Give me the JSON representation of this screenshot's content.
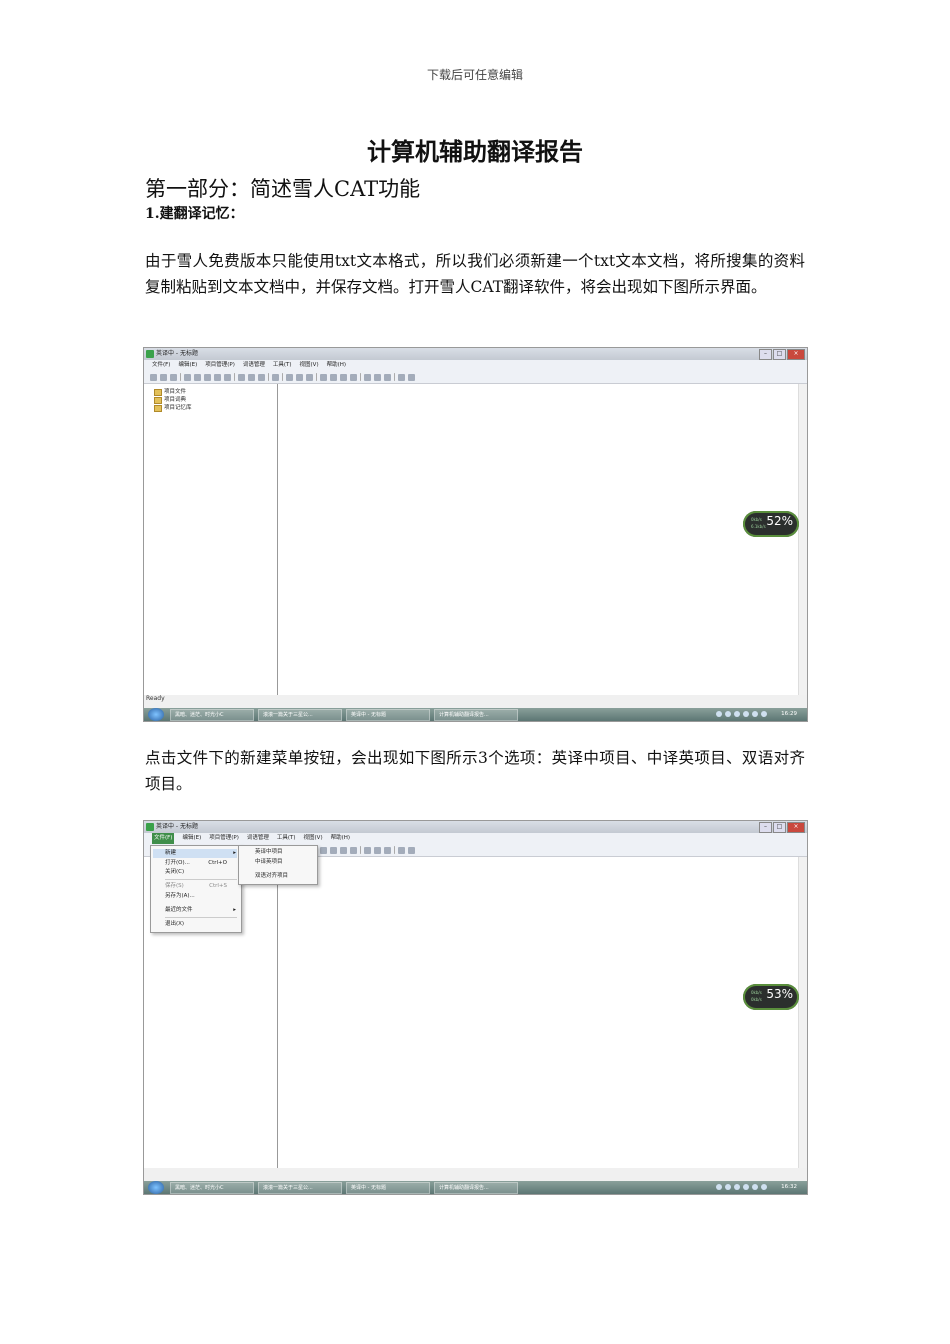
{
  "header": "下载后可任意编辑",
  "title": "计算机辅助翻译报告",
  "section_heading": "第一部分：简述雪人CAT功能",
  "subheading": "1.建翻译记忆：",
  "paragraph1": "由于雪人免费版本只能使用txt文本格式，所以我们必须新建一个txt文本文档，将所搜集的资料复制粘贴到文本文档中，并保存文档。打开雪人CAT翻译软件，将会出现如下图所示界面。",
  "paragraph2": "点击文件下的新建菜单按钮，会出现如下图所示3个选项：英译中项目、中译英项目、双语对齐项目。",
  "screenshot1": {
    "window_title": "英译中 - 无标题",
    "menu": [
      "文件(F)",
      "编辑(E)",
      "项目管理(P)",
      "词语管理",
      "工具(T)",
      "视图(V)",
      "帮助(H)"
    ],
    "tree": [
      "项目文件",
      "项目词典",
      "项目记忆库"
    ],
    "status": "Ready",
    "taskbar": [
      "黑暗、迷茫、时光小C",
      "滚滚一篇关于三星公...",
      "英译中 - 无标题",
      "计算机辅助翻译报告..."
    ],
    "clock": "16:29",
    "gadget_percent": "52%",
    "gadget_stats": [
      "0kb/s",
      "6.1kb/s"
    ]
  },
  "screenshot2": {
    "window_title": "英译中 - 无标题",
    "menu": [
      "文件(F)",
      "编辑(E)",
      "项目管理(P)",
      "词语管理",
      "工具(T)",
      "视图(V)",
      "帮助(H)"
    ],
    "file_menu": [
      {
        "label": "新建",
        "shortcut": "",
        "arrow": "▸"
      },
      {
        "label": "打开(O)...",
        "shortcut": "Ctrl+O",
        "arrow": ""
      },
      {
        "label": "关闭(C)",
        "shortcut": "",
        "arrow": ""
      },
      {
        "label": "保存(S)",
        "shortcut": "Ctrl+S",
        "arrow": ""
      },
      {
        "label": "另存为(A)...",
        "shortcut": "",
        "arrow": ""
      },
      {
        "label": "最近的文件",
        "shortcut": "",
        "arrow": "▸"
      },
      {
        "label": "退出(X)",
        "shortcut": "",
        "arrow": ""
      }
    ],
    "new_submenu": [
      "英译中项目",
      "中译英项目",
      "双语对齐项目"
    ],
    "taskbar": [
      "黑暗、迷茫、时光小C",
      "滚滚一篇关于三星公...",
      "英译中 - 无标题",
      "计算机辅助翻译报告..."
    ],
    "clock": "16:32",
    "gadget_percent": "53%",
    "gadget_stats": [
      "0kb/s",
      "0kb/s"
    ]
  }
}
